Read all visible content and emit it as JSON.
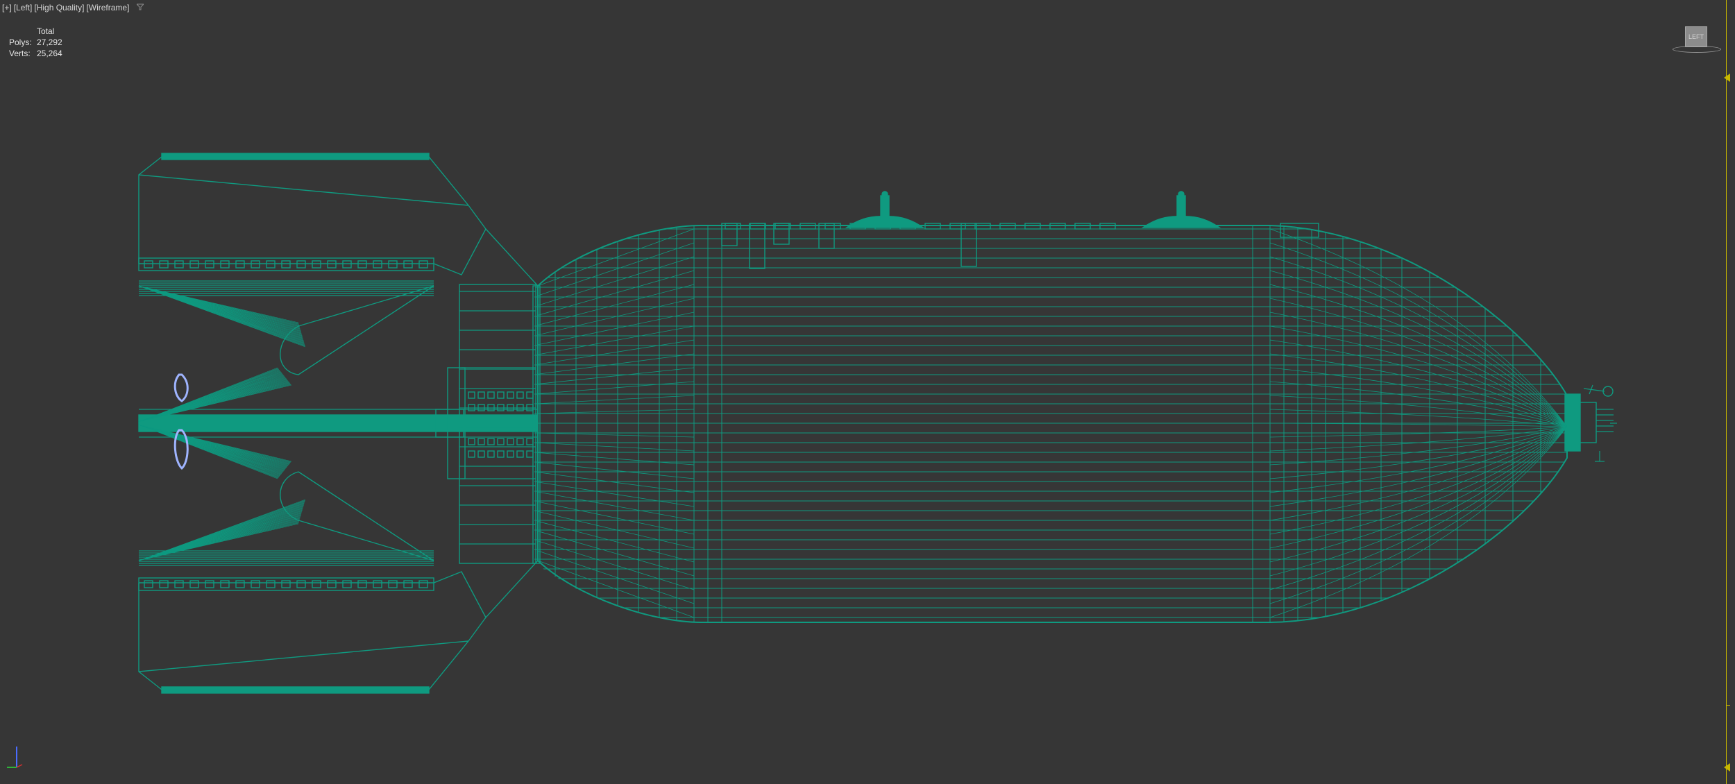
{
  "viewport": {
    "labels": [
      "[+]",
      "[Left]",
      "[High Quality]",
      "[Wireframe]"
    ],
    "filter_icon": "filter-icon"
  },
  "stats": {
    "title": "Total",
    "polys_label": "Polys:",
    "polys_value": "27,292",
    "verts_label": "Verts:",
    "verts_value": "25,264"
  },
  "viewcube": {
    "face_label": "LEFT"
  },
  "colors": {
    "background": "#363636",
    "wireframe": "#0f9a80",
    "selection_accent": "#9fb4ff",
    "timebar": "#c8b800"
  },
  "icons": [
    "filter-icon",
    "viewcube-icon",
    "axis-gizmo-icon",
    "time-marker-icon"
  ]
}
